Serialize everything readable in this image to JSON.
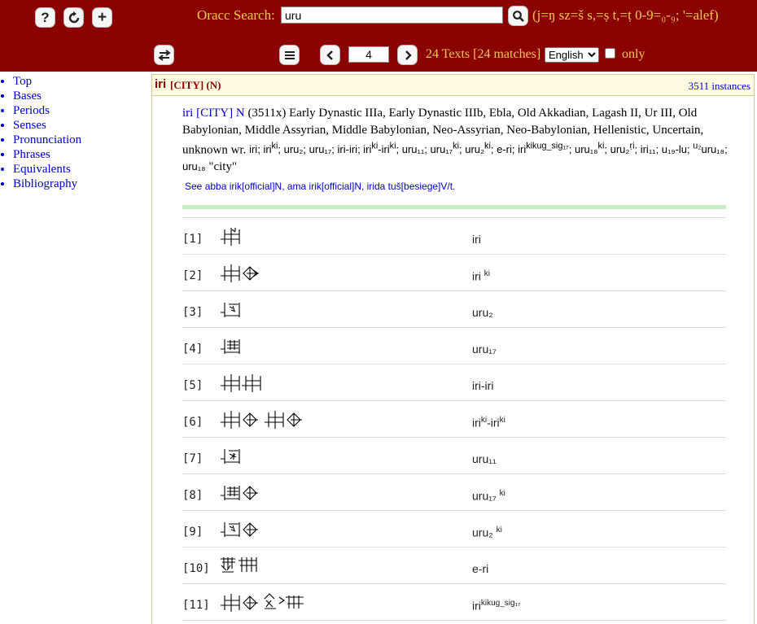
{
  "header": {
    "search_label": "Oracc Search:",
    "search_value": "uru",
    "hint": "(j=ŋ sz=š s,=ṣ t,=ṭ 0-9=₀-₉; '=alef)",
    "page_value": "4",
    "count": "24 Texts [24 matches]",
    "language": "English",
    "only_label": "only",
    "help_glyph": "?",
    "add_glyph": "+"
  },
  "sidebar": {
    "items": [
      {
        "label": "Top"
      },
      {
        "label": "Bases"
      },
      {
        "label": "Periods"
      },
      {
        "label": "Senses"
      },
      {
        "label": "Pronunciation"
      },
      {
        "label": "Phrases"
      },
      {
        "label": "Equivalents"
      },
      {
        "label": "Bibliography"
      }
    ]
  },
  "panel": {
    "word": "iri",
    "sense": "[CITY] (N)",
    "instances": "3511 instances"
  },
  "entry": {
    "cf": "iri",
    "gw": "[CITY]",
    "pos": "N",
    "count": "(3511x)",
    "periods": "Early Dynastic IIIa, Early Dynastic IIIb, Ebla, Old Akkadian, Lagash II, Ur III, Old Babylonian, Middle Assyrian, Middle Babylonian, Neo-Assyrian, Neo-Babylonian, Hellenistic, Uncertain, unknown",
    "wr": "wr.",
    "f1": "iri;",
    "f2": "iri",
    "f2s": "ki",
    "f3": "; uru₂; uru₁₇; iri-iri; iri",
    "f3s": "ki",
    "f4": "-iri",
    "f4s": "ki",
    "f5": "; uru₁₁; uru₁₇",
    "f5s": "ki",
    "f6": "; uru₂",
    "f6s": "ki",
    "f7": "; e-ri; iri",
    "f7s": "kikug_sig₁₇",
    "f8": "; uru₁₈",
    "f8s": "ki",
    "f9": ";",
    "f10": "uru₂",
    "f10s": "ṛi",
    "f11": "; iri₁₁; u₁₉-lu;",
    "f11p": "u₂",
    "f12": "uru₁₈; uru₁₈",
    "gloss": "\"city\"",
    "see_label": "See",
    "see_links": "abba irik[official]N, ama irik[official]N, irida tuš[besiege]V/t."
  },
  "rows": [
    {
      "num": "[1]",
      "tr": "iri",
      "sup": ""
    },
    {
      "num": "[2]",
      "tr": "iri ",
      "sup": "ki"
    },
    {
      "num": "[3]",
      "tr": "uru₂",
      "sup": ""
    },
    {
      "num": "[4]",
      "tr": "uru₁₇",
      "sup": ""
    },
    {
      "num": "[5]",
      "tr": "iri-iri",
      "sup": ""
    },
    {
      "num": "[6]",
      "tr": "iri",
      "sup": "ki",
      "tr2": "-iri",
      "sup2": "ki"
    },
    {
      "num": "[7]",
      "tr": "uru₁₁",
      "sup": ""
    },
    {
      "num": "[8]",
      "tr": "uru₁₇ ",
      "sup": "ki"
    },
    {
      "num": "[9]",
      "tr": "uru₂ ",
      "sup": "ki"
    },
    {
      "num": "[10]",
      "tr": "e-ri",
      "sup": ""
    },
    {
      "num": "[11]",
      "tr": "iri",
      "sup": "kikug_sig₁₇"
    }
  ],
  "icons": {
    "help": "help-icon",
    "reload": "reload-icon",
    "add": "add-icon",
    "search": "search-icon",
    "swap": "swap-icon",
    "menu": "menu-icon",
    "prev": "chevron-left-icon",
    "next": "chevron-right-icon"
  },
  "colors": {
    "header_bg": "#8b0000",
    "header_text": "#f0c85a",
    "link": "#0000cc",
    "panel_head_bg": "#fffbe0",
    "green_bar": "#c6f0c3"
  }
}
